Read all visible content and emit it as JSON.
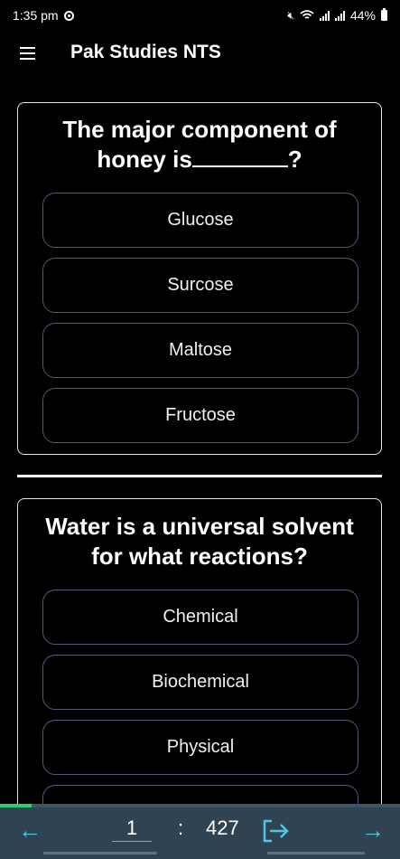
{
  "status": {
    "time": "1:35 pm",
    "battery": "44%"
  },
  "app_bar": {
    "title": "Pak Studies NTS",
    "menu_icon": "menu-icon"
  },
  "questions": [
    {
      "text_before_blank": "The major component of honey is",
      "text_after_blank": "?",
      "options": [
        "Glucose",
        "Surcose",
        "Maltose",
        "Fructose"
      ]
    },
    {
      "text": "Water is a universal solvent for what reactions?",
      "options": [
        "Chemical",
        "Biochemical",
        "Physical"
      ]
    }
  ],
  "navigation": {
    "current_page": "1",
    "separator": ":",
    "total_pages": "427",
    "progress_fraction": 0.08,
    "prev_icon": "arrow-left-icon",
    "next_icon": "arrow-right-icon",
    "exit_icon": "exit-icon",
    "accent_color": "#4fc7e0",
    "progress_color": "#2ecc71",
    "bar_color": "#2f4353"
  }
}
